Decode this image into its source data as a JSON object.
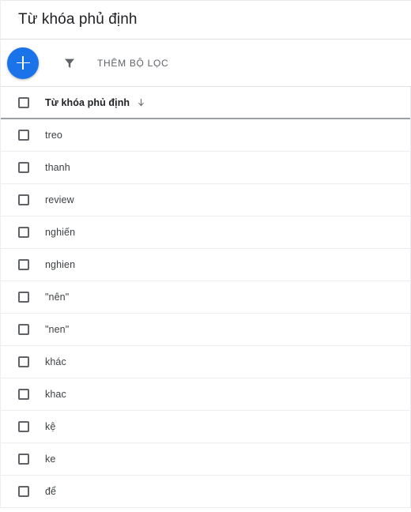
{
  "header": {
    "title": "Từ khóa phủ định"
  },
  "toolbar": {
    "add_button_label": "+",
    "add_icon": "plus-icon",
    "filter_icon": "filter-funnel-icon",
    "filter_label": "THÊM BỘ LỌC"
  },
  "colors": {
    "accent": "#1a73e8",
    "text_primary": "#202124",
    "text_secondary": "#5f6368",
    "row_border": "#ededed",
    "header_border": "#9aa0a6"
  },
  "table": {
    "select_all_checkbox": "select-all-checkbox",
    "columns": [
      {
        "label": "Từ khóa phủ định",
        "sorted": true,
        "sort_direction": "↓"
      }
    ],
    "rows": [
      {
        "keyword": "treo"
      },
      {
        "keyword": "thanh"
      },
      {
        "keyword": "review"
      },
      {
        "keyword": "nghiến"
      },
      {
        "keyword": "nghien"
      },
      {
        "keyword": "\"nên\""
      },
      {
        "keyword": "\"nen\""
      },
      {
        "keyword": "khác"
      },
      {
        "keyword": "khac"
      },
      {
        "keyword": "kệ"
      },
      {
        "keyword": "ke"
      },
      {
        "keyword": "để"
      }
    ]
  }
}
